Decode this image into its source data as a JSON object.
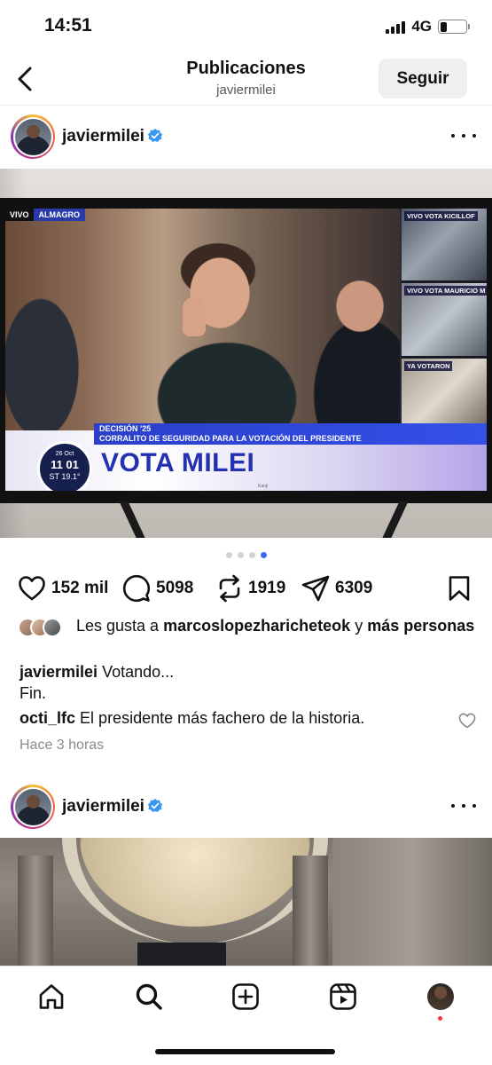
{
  "status_bar": {
    "time": "14:51",
    "network": "4G",
    "battery_level": 0.25
  },
  "header": {
    "title": "Publicaciones",
    "subtitle": "javiermilei",
    "follow_label": "Seguir"
  },
  "post1": {
    "username": "javiermilei",
    "verified": true,
    "image": {
      "tv_live": "VIVO",
      "tv_location": "ALMAGRO",
      "tv_side_labels": [
        "VIVO  VOTA KICILLOF",
        "VIVO  VOTA MAURICIO M",
        "YA VOTARON"
      ],
      "tv_strip_top": "DECISIÓN '25",
      "tv_strip_bottom": "CORRALITO DE SEGURIDAD PARA LA VOTACIÓN DEL PRESIDENTE",
      "tv_headline": "VOTA MILEI",
      "tv_clock_date": "26 Oct",
      "tv_clock_time": "11 01",
      "tv_clock_temp": "ST 19.1°",
      "tv_brand": "Kanji"
    },
    "carousel": {
      "total": 4,
      "active_index": 3
    },
    "actions": {
      "likes": "152 mil",
      "comments": "5098",
      "reposts": "1919",
      "shares": "6309"
    },
    "likes_prefix": "Les gusta a",
    "likes_user": "marcoslopezharicheteok",
    "likes_joiner": "y",
    "likes_suffix": "más personas",
    "caption_user": "javiermilei",
    "caption_line1": "Votando...",
    "caption_line2": "Fin.",
    "comment_user": "octi_lfc",
    "comment_text": "El presidente más fachero de la historia.",
    "time_ago": "Hace 3 horas"
  },
  "post2": {
    "username": "javiermilei",
    "verified": true
  },
  "colors": {
    "verified_blue": "#3897f0",
    "accent_blue": "#3b6bf0",
    "notification_red": "#ff3040"
  },
  "nav": {
    "icons": [
      "home-icon",
      "search-icon",
      "create-icon",
      "reels-icon",
      "profile-avatar"
    ]
  }
}
